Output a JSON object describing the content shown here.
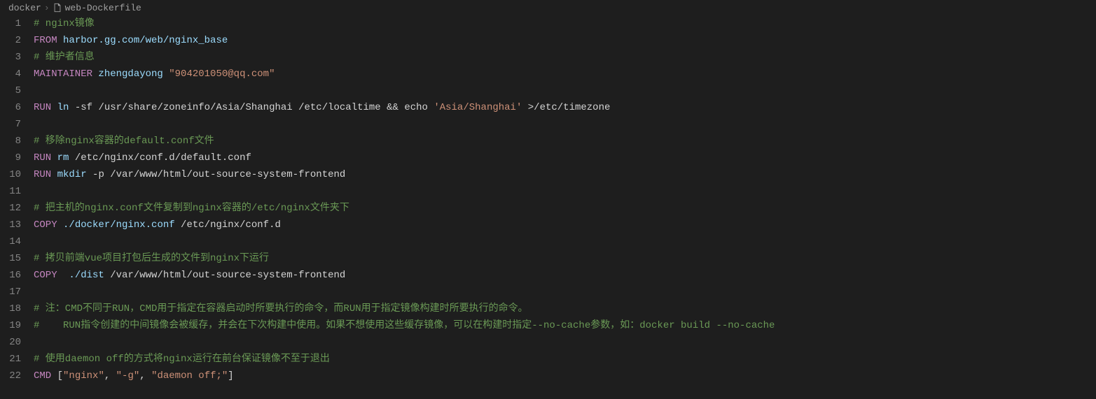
{
  "breadcrumb": {
    "folder": "docker",
    "file": "web-Dockerfile"
  },
  "lines": [
    {
      "n": 1,
      "tokens": [
        [
          "comment",
          "# nginx镜像"
        ]
      ]
    },
    {
      "n": 2,
      "tokens": [
        [
          "keyword",
          "FROM"
        ],
        [
          "plain",
          " "
        ],
        [
          "ident",
          "harbor.gg.com/web/nginx_base"
        ]
      ]
    },
    {
      "n": 3,
      "tokens": [
        [
          "comment",
          "# 维护者信息"
        ]
      ]
    },
    {
      "n": 4,
      "tokens": [
        [
          "keyword",
          "MAINTAINER"
        ],
        [
          "plain",
          " "
        ],
        [
          "ident",
          "zhengdayong"
        ],
        [
          "plain",
          " "
        ],
        [
          "string",
          "\"904201050@qq.com\""
        ]
      ]
    },
    {
      "n": 5,
      "tokens": []
    },
    {
      "n": 6,
      "tokens": [
        [
          "keyword",
          "RUN"
        ],
        [
          "plain",
          " "
        ],
        [
          "ident",
          "ln"
        ],
        [
          "plain",
          " -sf /usr/share/zoneinfo/Asia/Shanghai /etc/localtime && echo "
        ],
        [
          "string",
          "'Asia/Shanghai'"
        ],
        [
          "plain",
          " >/etc/timezone"
        ]
      ]
    },
    {
      "n": 7,
      "tokens": []
    },
    {
      "n": 8,
      "tokens": [
        [
          "comment",
          "# 移除nginx容器的default.conf文件"
        ]
      ]
    },
    {
      "n": 9,
      "tokens": [
        [
          "keyword",
          "RUN"
        ],
        [
          "plain",
          " "
        ],
        [
          "ident",
          "rm"
        ],
        [
          "plain",
          " /etc/nginx/conf.d/default.conf"
        ]
      ]
    },
    {
      "n": 10,
      "tokens": [
        [
          "keyword",
          "RUN"
        ],
        [
          "plain",
          " "
        ],
        [
          "ident",
          "mkdir"
        ],
        [
          "plain",
          " -p /var/www/html/out-source-system-frontend"
        ]
      ]
    },
    {
      "n": 11,
      "tokens": []
    },
    {
      "n": 12,
      "tokens": [
        [
          "comment",
          "# 把主机的nginx.conf文件复制到nginx容器的/etc/nginx文件夹下"
        ]
      ]
    },
    {
      "n": 13,
      "tokens": [
        [
          "keyword",
          "COPY"
        ],
        [
          "plain",
          " "
        ],
        [
          "ident",
          "./docker/nginx.conf"
        ],
        [
          "plain",
          " /etc/nginx/conf.d"
        ]
      ]
    },
    {
      "n": 14,
      "tokens": []
    },
    {
      "n": 15,
      "tokens": [
        [
          "comment",
          "# 拷贝前端vue项目打包后生成的文件到nginx下运行"
        ]
      ]
    },
    {
      "n": 16,
      "tokens": [
        [
          "keyword",
          "COPY"
        ],
        [
          "plain",
          "  "
        ],
        [
          "ident",
          "./dist"
        ],
        [
          "plain",
          " /var/www/html/out-source-system-frontend"
        ]
      ]
    },
    {
      "n": 17,
      "tokens": []
    },
    {
      "n": 18,
      "tokens": [
        [
          "comment",
          "# 注：CMD不同于RUN，CMD用于指定在容器启动时所要执行的命令，而RUN用于指定镜像构建时所要执行的命令。"
        ]
      ]
    },
    {
      "n": 19,
      "tokens": [
        [
          "comment",
          "#    RUN指令创建的中间镜像会被缓存，并会在下次构建中使用。如果不想使用这些缓存镜像，可以在构建时指定--no-cache参数，如：docker build --no-cache"
        ]
      ]
    },
    {
      "n": 20,
      "tokens": []
    },
    {
      "n": 21,
      "tokens": [
        [
          "comment",
          "# 使用daemon off的方式将nginx运行在前台保证镜像不至于退出"
        ]
      ]
    },
    {
      "n": 22,
      "tokens": [
        [
          "keyword",
          "CMD"
        ],
        [
          "plain",
          " "
        ],
        [
          "punc",
          "["
        ],
        [
          "string",
          "\"nginx\""
        ],
        [
          "plain",
          ", "
        ],
        [
          "string",
          "\"-g\""
        ],
        [
          "plain",
          ", "
        ],
        [
          "string",
          "\"daemon off;\""
        ],
        [
          "punc",
          "]"
        ]
      ]
    }
  ]
}
